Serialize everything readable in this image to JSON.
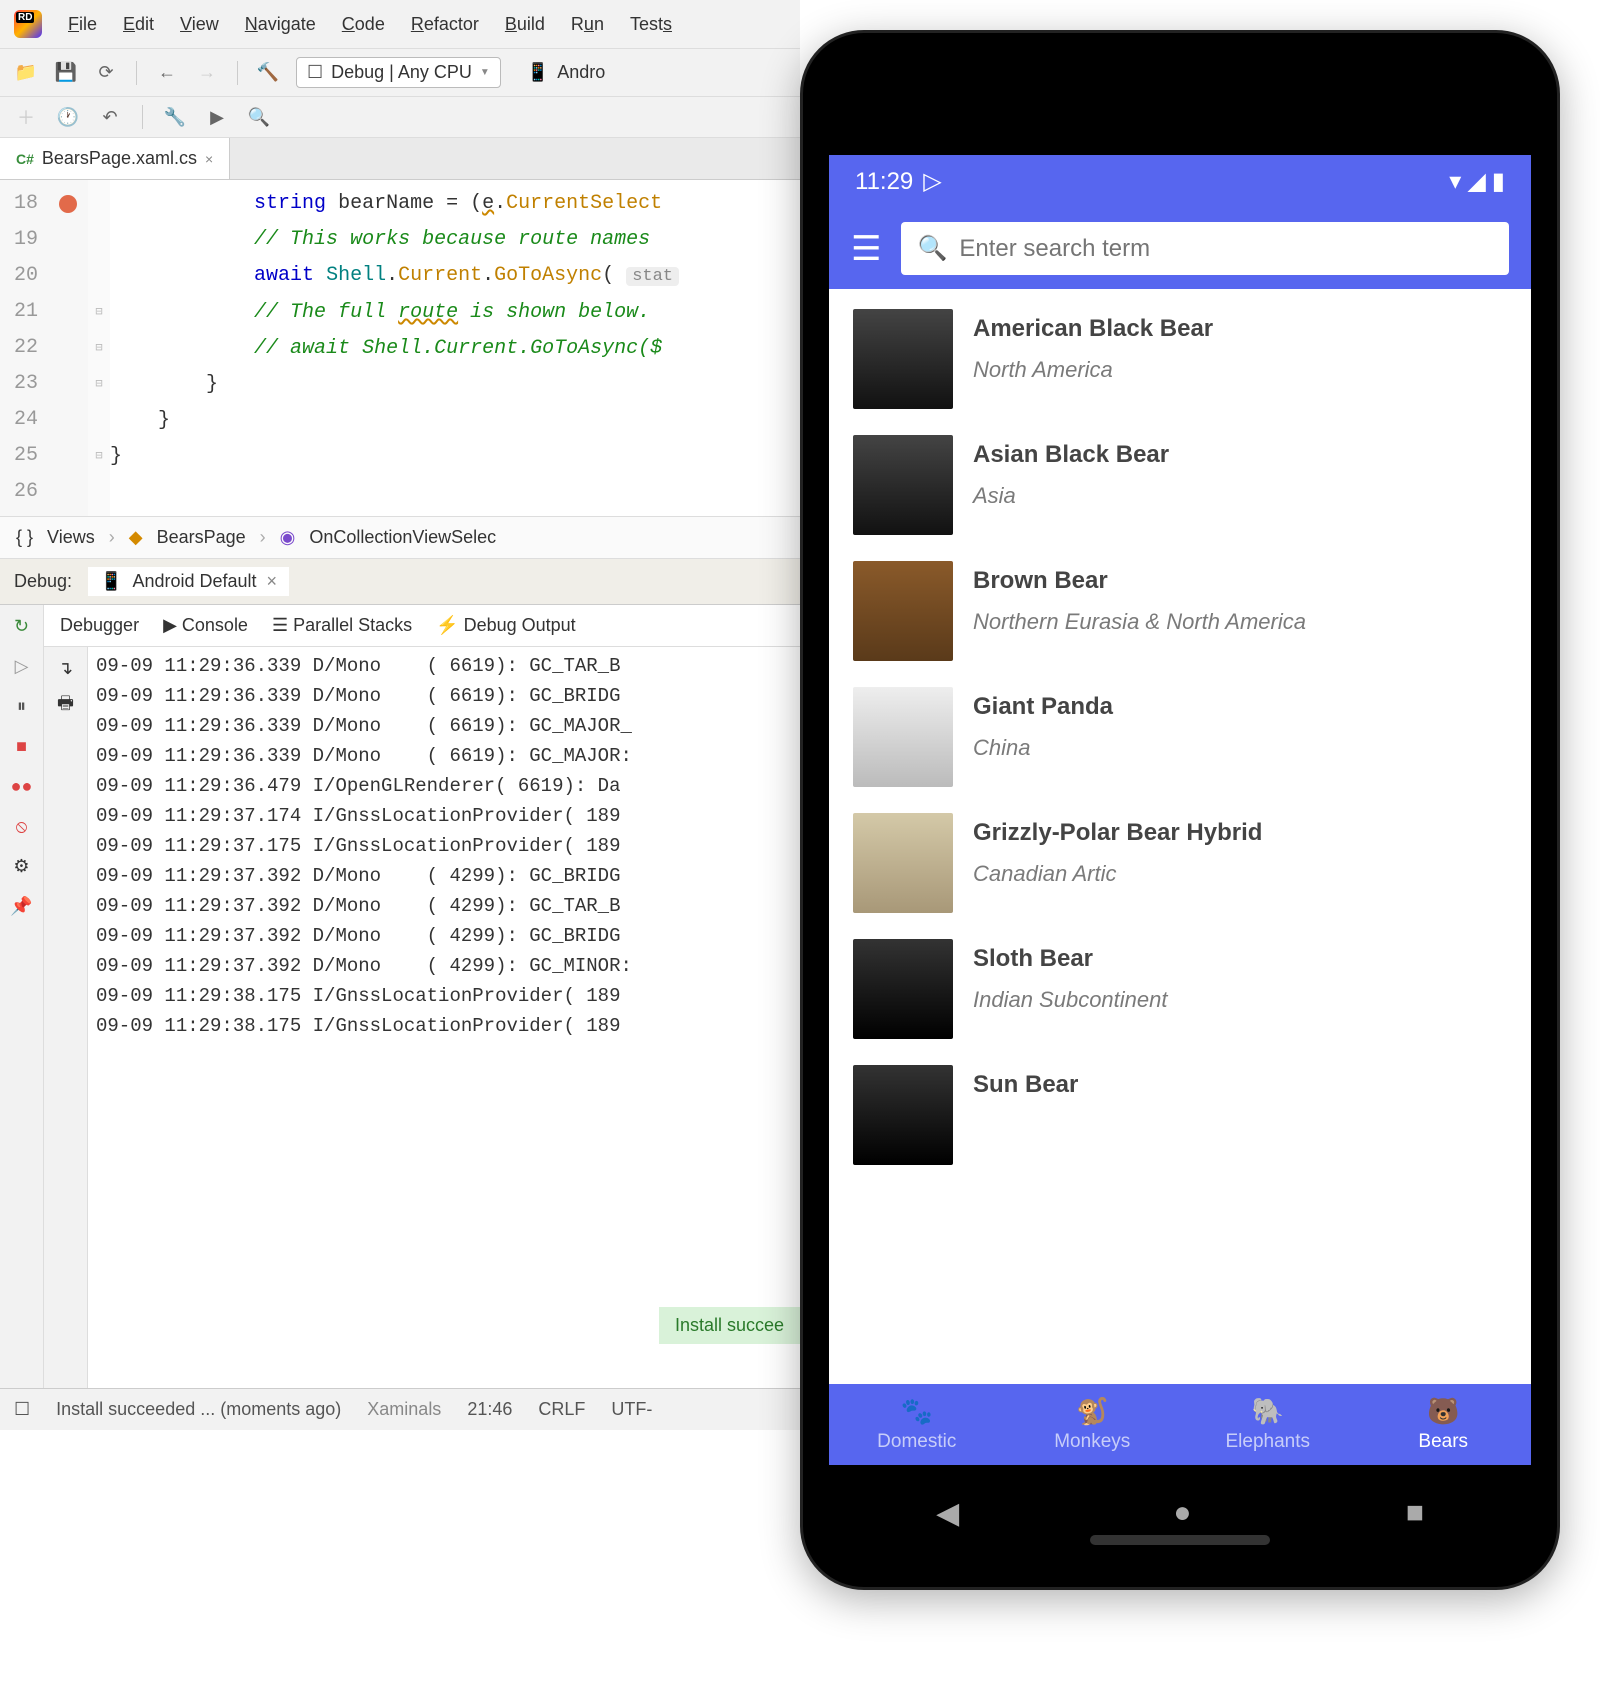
{
  "menubar": {
    "items": [
      "File",
      "Edit",
      "View",
      "Navigate",
      "Code",
      "Refactor",
      "Build",
      "Run",
      "Tests"
    ]
  },
  "toolbar": {
    "config": "Debug | Any CPU",
    "target": "Andro"
  },
  "tab": {
    "filename": "BearsPage.xaml.cs",
    "lang": "C#"
  },
  "code": {
    "lines": [
      {
        "n": "18",
        "txt": "string bearName = (e.CurrentSelect"
      },
      {
        "n": "19",
        "txt": "// This works because route names "
      },
      {
        "n": "20",
        "txt": "await Shell.Current.GoToAsync( stat"
      },
      {
        "n": "21",
        "txt": "// The full route is shown below. "
      },
      {
        "n": "22",
        "txt": "// await Shell.Current.GoToAsync($"
      },
      {
        "n": "23",
        "txt": "}"
      },
      {
        "n": "24",
        "txt": "}"
      },
      {
        "n": "25",
        "txt": "}"
      },
      {
        "n": "26",
        "txt": ""
      }
    ]
  },
  "breadcrumb": {
    "items": [
      "Views",
      "BearsPage",
      "OnCollectionViewSelec"
    ]
  },
  "debug": {
    "label": "Debug:",
    "session": "Android Default",
    "tabs": [
      "Debugger",
      "Console",
      "Parallel Stacks",
      "Debug Output"
    ],
    "logs": [
      "09-09 11:29:36.339 D/Mono    ( 6619): GC_TAR_B",
      "09-09 11:29:36.339 D/Mono    ( 6619): GC_BRIDG",
      "09-09 11:29:36.339 D/Mono    ( 6619): GC_MAJOR_",
      "09-09 11:29:36.339 D/Mono    ( 6619): GC_MAJOR:",
      "09-09 11:29:36.479 I/OpenGLRenderer( 6619): Da",
      "09-09 11:29:37.174 I/GnssLocationProvider( 189",
      "09-09 11:29:37.175 I/GnssLocationProvider( 189",
      "09-09 11:29:37.392 D/Mono    ( 4299): GC_BRIDG",
      "09-09 11:29:37.392 D/Mono    ( 4299): GC_TAR_B",
      "09-09 11:29:37.392 D/Mono    ( 4299): GC_BRIDG",
      "09-09 11:29:37.392 D/Mono    ( 4299): GC_MINOR:",
      "09-09 11:29:38.175 I/GnssLocationProvider( 189",
      "09-09 11:29:38.175 I/GnssLocationProvider( 189"
    ],
    "toast": "Install succee"
  },
  "statusbar": {
    "msg": "Install succeeded ... (moments ago)",
    "project": "Xaminals",
    "time": "21:46",
    "eol": "CRLF",
    "enc": "UTF-"
  },
  "phone": {
    "status_time": "11:29",
    "search_placeholder": "Enter search term",
    "bears": [
      {
        "name": "American Black Bear",
        "loc": "North America",
        "cls": "black"
      },
      {
        "name": "Asian Black Bear",
        "loc": "Asia",
        "cls": "black"
      },
      {
        "name": "Brown Bear",
        "loc": "Northern Eurasia & North America",
        "cls": "brown"
      },
      {
        "name": "Giant Panda",
        "loc": "China",
        "cls": "panda"
      },
      {
        "name": "Grizzly-Polar Bear Hybrid",
        "loc": "Canadian Artic",
        "cls": "cream"
      },
      {
        "name": "Sloth Bear",
        "loc": "Indian Subcontinent",
        "cls": "dark"
      },
      {
        "name": "Sun Bear",
        "loc": "",
        "cls": "dark"
      }
    ],
    "tabs": [
      {
        "label": "Domestic",
        "icon": "🐾"
      },
      {
        "label": "Monkeys",
        "icon": "🐒"
      },
      {
        "label": "Elephants",
        "icon": "🐘"
      },
      {
        "label": "Bears",
        "icon": "🐻",
        "active": true
      }
    ]
  }
}
